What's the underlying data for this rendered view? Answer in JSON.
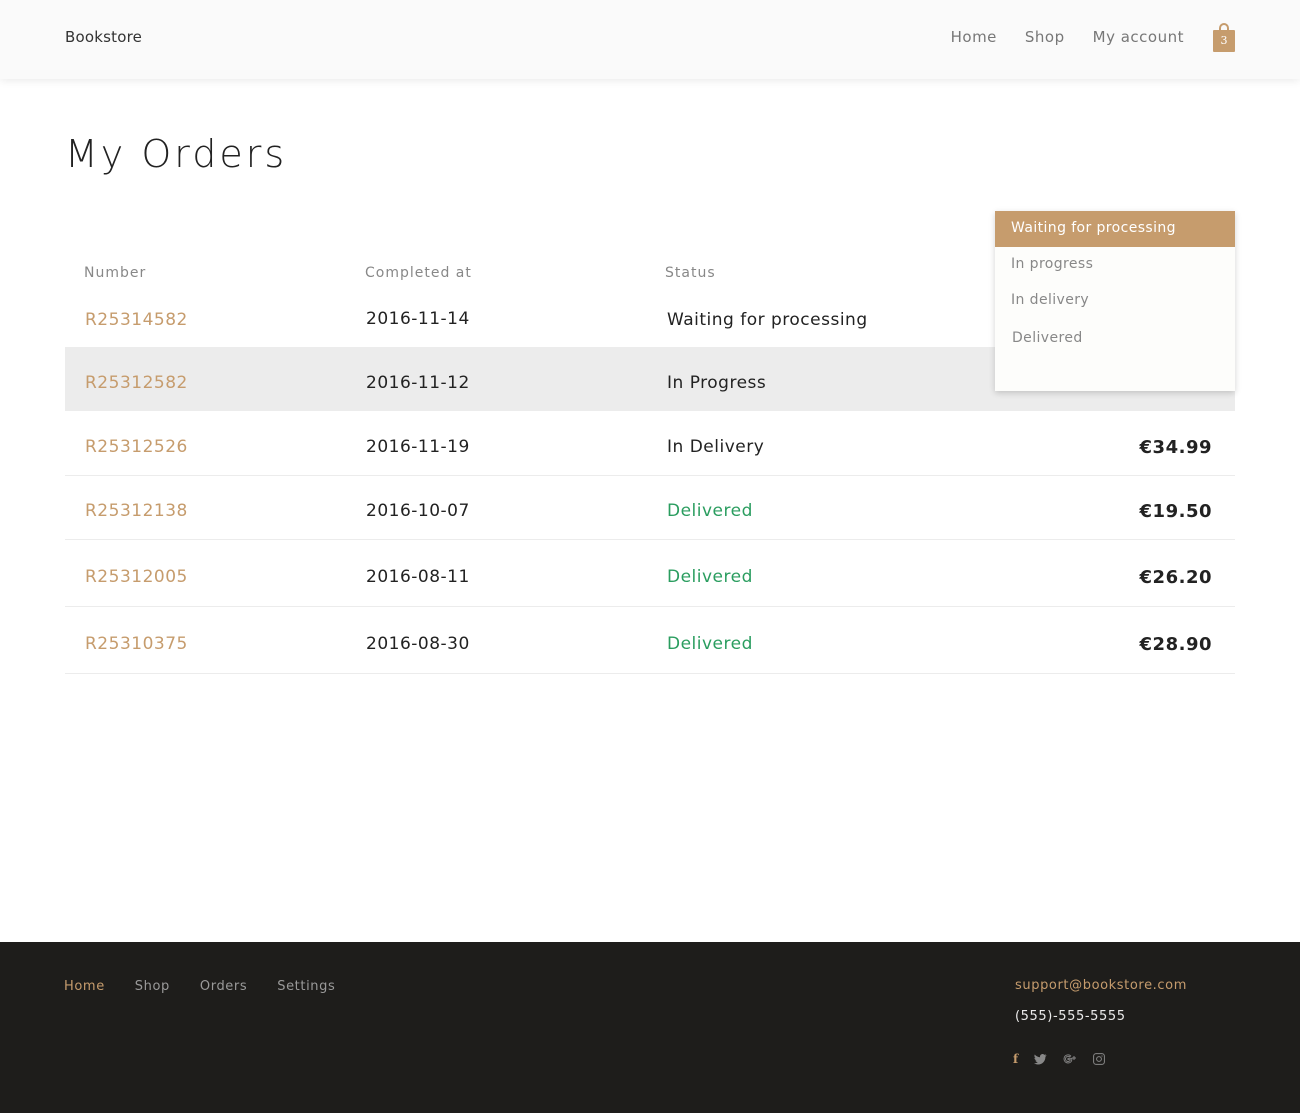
{
  "header": {
    "brand": "Bookstore",
    "nav": [
      "Home",
      "Shop",
      "My account"
    ],
    "cart_count": "3"
  },
  "page": {
    "title": "My Orders"
  },
  "table": {
    "columns": [
      "Number",
      "Completed at",
      "Status"
    ],
    "rows": [
      {
        "number": "R25314582",
        "date": "2016-11-14",
        "status": "Waiting for processing",
        "total": ""
      },
      {
        "number": "R25312582",
        "date": "2016-11-12",
        "status": "In Progress",
        "total": ""
      },
      {
        "number": "R25312526",
        "date": "2016-11-19",
        "status": "In Delivery",
        "total": "€34.99"
      },
      {
        "number": "R25312138",
        "date": "2016-10-07",
        "status": "Delivered",
        "total": "€19.50"
      },
      {
        "number": "R25312005",
        "date": "2016-08-11",
        "status": "Delivered",
        "total": "€26.20"
      },
      {
        "number": "R25310375",
        "date": "2016-08-30",
        "status": "Delivered",
        "total": "€28.90"
      }
    ]
  },
  "status_dropdown": {
    "options": [
      "Waiting for processing",
      "In progress",
      "In delivery",
      "Delivered"
    ],
    "selected": "Waiting for processing"
  },
  "footer": {
    "nav": [
      "Home",
      "Shop",
      "Orders",
      "Settings"
    ],
    "email": "support@bookstore.com",
    "phone": "(555)-555-5555",
    "social_icons": [
      "facebook-icon",
      "twitter-icon",
      "google-plus-icon",
      "instagram-icon"
    ]
  },
  "colors": {
    "accent": "#c69c6d",
    "delivered": "#2a9d5f",
    "footer_bg": "#1e1d1b",
    "row_highlight": "#ececec"
  }
}
